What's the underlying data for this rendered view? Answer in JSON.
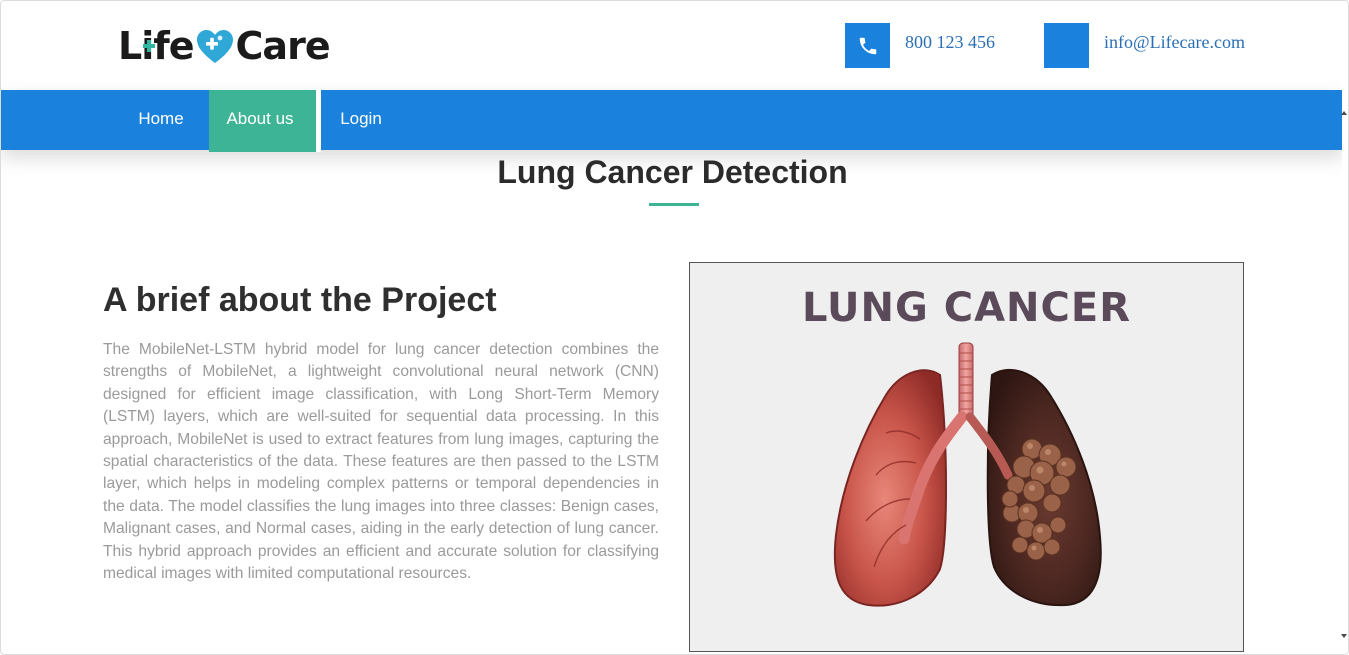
{
  "brand": {
    "logo_left": "Life",
    "logo_right": "Care",
    "heart_color": "#2fa8d8",
    "plus_color": "#2fb5a0"
  },
  "contact": {
    "phone": "800 123 456",
    "email": "info@Lifecare.com",
    "phone_icon": "phone-icon",
    "email_icon": "email-icon"
  },
  "nav": {
    "items": [
      {
        "label": "Home"
      },
      {
        "label": "About us",
        "active": true
      },
      {
        "label": "Login"
      }
    ]
  },
  "page": {
    "title": "Lung Cancer Detection"
  },
  "about": {
    "heading": "A brief about the Project",
    "description": "The MobileNet-LSTM hybrid model for lung cancer detection combines the strengths of MobileNet, a lightweight convolutional neural network (CNN) designed for efficient image classification, with Long Short-Term Memory (LSTM) layers, which are well-suited for sequential data processing. In this approach, MobileNet is used to extract features from lung images, capturing the spatial characteristics of the data. These features are then passed to the LSTM layer, which helps in modeling complex patterns or temporal dependencies in the data. The model classifies the lung images into three classes: Benign cases, Malignant cases, and Normal cases, aiding in the early detection of lung cancer. This hybrid approach provides an efficient and accurate solution for classifying medical images with limited computational resources."
  },
  "illustration": {
    "title": "LUNG CANCER"
  },
  "colors": {
    "primary_blue": "#1a82dc",
    "accent_teal": "#3eb497",
    "text_dark": "#2b2b2b",
    "text_muted": "#9a9a9a"
  }
}
